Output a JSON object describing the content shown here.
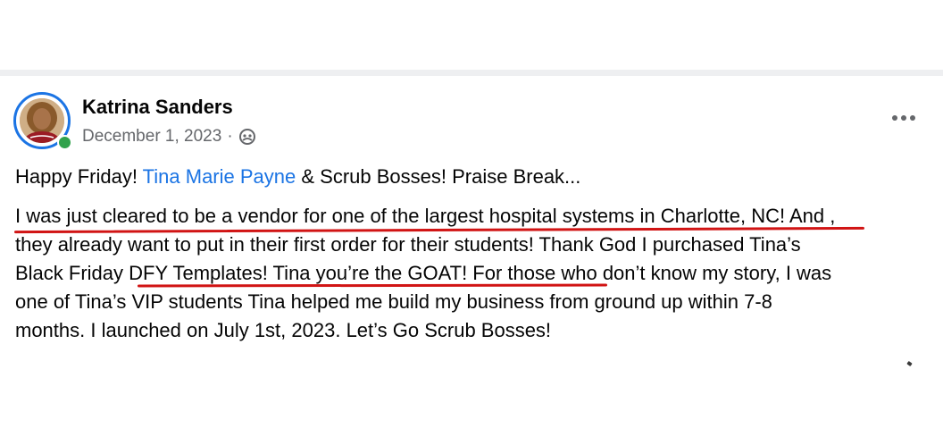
{
  "post": {
    "author": "Katrina Sanders",
    "date": "December 1, 2023",
    "separator": "·",
    "audience_icon": "friends-icon",
    "more_icon": "more-options-icon",
    "body": {
      "line1_prefix": "Happy Friday! ",
      "mention": "Tina Marie Payne",
      "line1_suffix": " & Scrub Bosses! Praise Break...",
      "line2": "I was just cleared to be a vendor for one of the largest hospital systems in Charlotte, NC! And ,",
      "line3": "they already want to put in their first order for their students! Thank God I purchased Tina’s",
      "line4": "Black Friday DFY Templates! Tina you’re the GOAT! For those who don’t know my story, I was",
      "line5": "one of Tina’s VIP students Tina helped me build my business from ground up within 7-8",
      "line6": "months. I launched on July 1st, 2023. Let’s Go Scrub Bosses!"
    }
  },
  "colors": {
    "mention": "#1b74e4",
    "ring": "#1b74e4",
    "online": "#31a24c",
    "annotation": "#d11414",
    "meta": "#65676b",
    "divider": "#eeeff1"
  }
}
